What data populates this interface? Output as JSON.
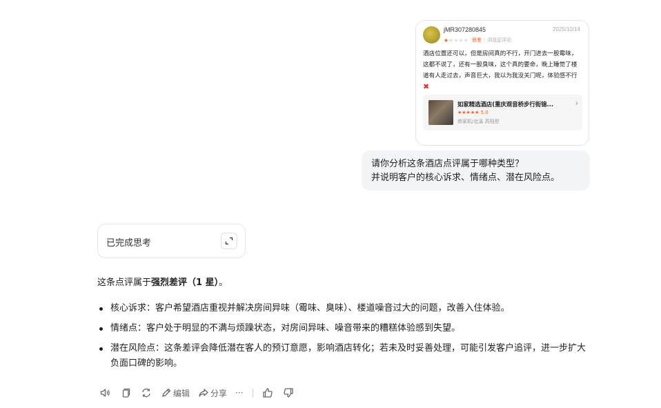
{
  "review_card": {
    "username": "jMR307280845",
    "date": "2025/10/14",
    "rating_stars_filled": 1,
    "rating_stars_total": 5,
    "rating_word": "很差",
    "rating_note": "浏览足评论",
    "text": "酒店位置还可以，但是房间真的不行，开门进去一股霉味，这都不说了，还有一股臭味，这个真的要命，晚上睡觉了楼道有人走过去，声音巨大，我以为我没关门呢，体验感不行",
    "hotel": {
      "name": "如家精选酒店(重庆观音桥步行街锦...",
      "rating_stars": "★★★★★",
      "rating_value": "5.0",
      "tags": "商家机/北溪 高档型"
    }
  },
  "question": {
    "line1": "请你分析这条酒店点评属于哪种类型？",
    "line2": "并说明客户的核心诉求、情绪点、潜在风险点。"
  },
  "thinking": {
    "label": "已完成思考"
  },
  "answer": {
    "intro_prefix": "这条点评属于",
    "intro_bold": "强烈差评（1 星）",
    "intro_suffix": "。",
    "bullets": [
      "核心诉求：客户希望酒店重视并解决房间异味（霉味、臭味）、楼道噪音过大的问题，改善入住体验。",
      "情绪点：客户处于明显的不满与烦躁状态，对房间异味、噪音带来的糟糕体验感到失望。",
      "潜在风险点：这条差评会降低潜在客人的预订意愿，影响酒店转化；若未及时妥善处理，可能引发客户追评，进一步扩大负面口碑的影响。"
    ]
  },
  "actions": {
    "edit_label": "编辑",
    "share_label": "分享",
    "more_label": "···"
  }
}
